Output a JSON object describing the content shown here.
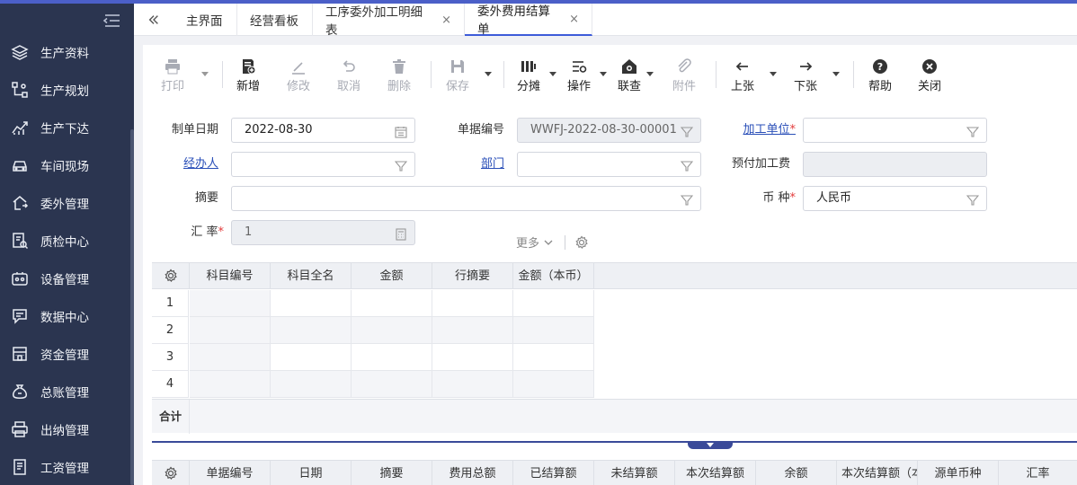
{
  "sidebar": {
    "items": [
      {
        "label": "生产资料",
        "icon": "layers-icon"
      },
      {
        "label": "生产规划",
        "icon": "flow-icon"
      },
      {
        "label": "生产下达",
        "icon": "chart-line-icon"
      },
      {
        "label": "车间现场",
        "icon": "car-icon"
      },
      {
        "label": "委外管理",
        "icon": "house-arrow-icon"
      },
      {
        "label": "质检中心",
        "icon": "inspect-icon"
      },
      {
        "label": "设备管理",
        "icon": "device-icon"
      },
      {
        "label": "数据中心",
        "icon": "data-icon"
      },
      {
        "label": "资金管理",
        "icon": "building-icon"
      },
      {
        "label": "总账管理",
        "icon": "moneybag-icon"
      },
      {
        "label": "出纳管理",
        "icon": "printer-icon"
      },
      {
        "label": "工资管理",
        "icon": "document-icon"
      }
    ]
  },
  "tabs": [
    {
      "label": "主界面",
      "closable": false,
      "active": false
    },
    {
      "label": "经营看板",
      "closable": false,
      "active": false
    },
    {
      "label": "工序委外加工明细表",
      "closable": true,
      "active": false
    },
    {
      "label": "委外费用结算单",
      "closable": true,
      "active": true
    }
  ],
  "tab_close_glyph": "×",
  "toolbar": {
    "print": "打印",
    "add": "新增",
    "edit": "修改",
    "cancel": "取消",
    "delete": "删除",
    "save": "保存",
    "allocate": "分摊",
    "operate": "操作",
    "query": "联查",
    "attach": "附件",
    "prev": "上张",
    "next": "下张",
    "help": "帮助",
    "close": "关闭"
  },
  "form": {
    "date_label": "制单日期",
    "date_value": "2022-08-30",
    "docno_label": "单据编号",
    "docno_value": "WWFJ-2022-08-30-00001",
    "unit_label": "加工单位",
    "unit_value": "",
    "handler_label": "经办人",
    "handler_value": "",
    "dept_label": "部门",
    "dept_value": "",
    "prepay_label": "预付加工费",
    "prepay_value": "",
    "summary_label": "摘要",
    "summary_value": "",
    "currency_label": "币 种",
    "currency_value": "人民币",
    "rate_label": "汇 率",
    "rate_value": "1",
    "required_mark": "*",
    "more_label": "更多"
  },
  "grid1": {
    "columns": [
      "科目编号",
      "科目全名",
      "金额",
      "行摘要",
      "金额（本币）"
    ],
    "rows": [
      "1",
      "2",
      "3",
      "4"
    ],
    "total_label": "合计"
  },
  "grid2": {
    "columns": [
      "单据编号",
      "日期",
      "摘要",
      "费用总额",
      "已结算额",
      "未结算额",
      "本次结算额",
      "余额",
      "本次结算额（本",
      "源单币种",
      "汇率"
    ]
  },
  "colors": {
    "sidebar_bg": "#2b3550",
    "accent": "#3d5bd9",
    "link": "#2a4fb8",
    "required": "#e23b3b"
  }
}
